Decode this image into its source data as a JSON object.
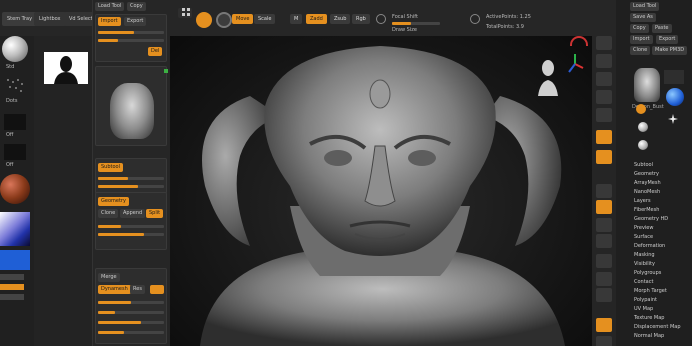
{
  "topbar": {
    "tabs": [
      "Stem Tray",
      "Lightbox",
      "Vd Selection"
    ],
    "buttons": [
      "Mrg",
      "Edit",
      "Move",
      "Scale",
      "Rotate",
      "Rgb",
      "M",
      "Zadd",
      "Zsub"
    ],
    "focal_label": "Focal Shift",
    "draw_label": "Draw Size",
    "readout_1": "ActivePoints: 1.25",
    "readout_2": "TotalPoints: 3.9"
  },
  "leftshelf": {
    "brush_label": "Std",
    "stroke_label": "Dots",
    "alpha_label": "Off",
    "texture_label": "Off",
    "material_label": "Mat",
    "gradient_label": "Grad",
    "swatch_label": "Clr",
    "colors": {
      "primary": "#d8d8d8",
      "accent": "#e5901f",
      "blue": "#1f5fd6",
      "material": "#8a3a1a"
    }
  },
  "colpanel": {
    "header_buttons": [
      "Load Tool",
      "Copy",
      "Import",
      "Export"
    ],
    "tool_name": "Bust_Demon",
    "card_buttons": [
      "Subtool",
      "Geometry",
      "Clone",
      "Make PolyMesh3D",
      "Append",
      "Split",
      "Merge",
      "Dynamesh",
      "Del",
      "Res",
      "Mask",
      "Polish",
      "Blur",
      "Sharpen",
      "Deformation",
      "Surface"
    ]
  },
  "rightpanel": {
    "top_buttons": [
      "Load Tool",
      "Save As",
      "Copy",
      "Paste",
      "Import",
      "Export",
      "Clone",
      "Make PM3D",
      "Go Z",
      "All",
      "Visible",
      "R"
    ],
    "thumb_labels": [
      "Demon_Bust",
      "Cylinder3D",
      "PolyMesh3D",
      "SimpleBrush",
      "Sphere3D",
      "Plane3D"
    ],
    "menu": [
      "Subtool",
      "Geometry",
      "ArrayMesh",
      "NanoMesh",
      "Layers",
      "FiberMesh",
      "Geometry HD",
      "Preview",
      "Surface",
      "Deformation",
      "Masking",
      "Visibility",
      "Polygroups",
      "Contact",
      "Morph Target",
      "Polypaint",
      "UV Map",
      "Texture Map",
      "Displacement Map",
      "Normal Map",
      "Vector Displacement Map"
    ]
  },
  "righticons": [
    "Bpr",
    "Scroll",
    "Zoom",
    "Actual",
    "AAHalf",
    "Persp",
    "Floor",
    "Local",
    "Gizmo",
    "Xyz",
    "Frame",
    "Move",
    "Scale",
    "Rotate",
    "Line Fill",
    "PolyF",
    "Transp",
    "Ghost",
    "Solo",
    "Xpose"
  ]
}
